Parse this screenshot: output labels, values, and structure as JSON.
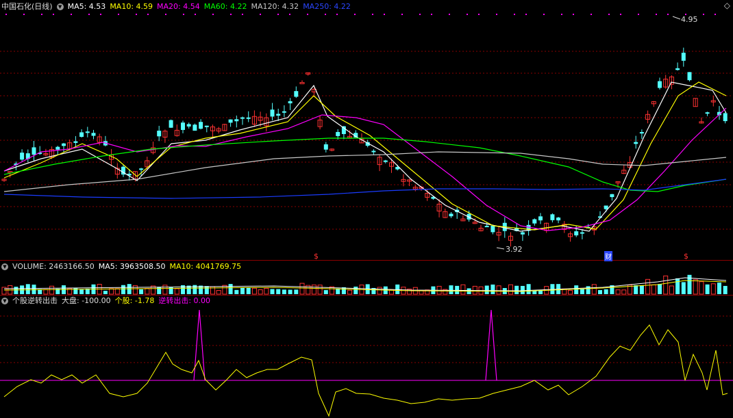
{
  "header": {
    "stock_title": "中国石化(日线)",
    "ma": [
      {
        "label": "MA5: 4.53",
        "color": "#ffffff"
      },
      {
        "label": "MA10: 4.59",
        "color": "#ffff00"
      },
      {
        "label": "MA20: 4.54",
        "color": "#ff00ff"
      },
      {
        "label": "MA60: 4.22",
        "color": "#00ff00"
      },
      {
        "label": "MA120: 4.32",
        "color": "#c8c8c8"
      },
      {
        "label": "MA250: 4.22",
        "color": "#1a3cff"
      }
    ]
  },
  "volume_header": {
    "volume": "VOLUME: 2463166.50",
    "ma5": "MA5: 3963508.50",
    "ma10": "MA10: 4041769.75"
  },
  "indicator_header": {
    "name": "个股逆转出击",
    "market": "大盘: -100.00",
    "stock": "个股: -1.78",
    "reversal": "逆转出击: 0.00"
  },
  "annotations": {
    "high_label": "4.95",
    "low_label": "3.92",
    "cai_mark": "财",
    "dollar_mark": "$"
  },
  "icons": {
    "header": "circle-icon",
    "corner": "diamond-icon"
  },
  "colors": {
    "up": "#ff3232",
    "down": "#54ffff",
    "grid": "#8b0000",
    "indicator_yellow": "#ffff00",
    "indicator_magenta": "#ff00ff"
  },
  "chart_data": {
    "type": "candlestick",
    "price_axis_low": 3.92,
    "price_axis_high": 4.95,
    "ma_values": {
      "MA5": 4.53,
      "MA10": 4.59,
      "MA20": 4.54,
      "MA60": 4.22,
      "MA120": 4.32,
      "MA250": 4.22
    },
    "candle_count": 122
  }
}
